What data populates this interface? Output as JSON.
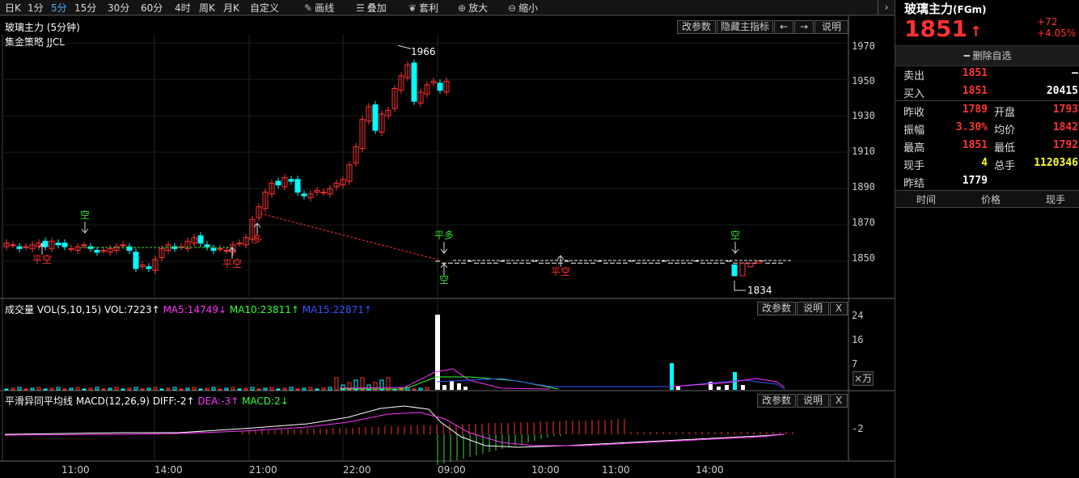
{
  "toolbar": {
    "items": [
      "日K",
      "1分",
      "5分",
      "15分",
      "30分",
      "60分",
      "4时",
      "周K",
      "月K",
      "自定义"
    ],
    "active_index": 2,
    "draw_label": "画线",
    "overlay_label": "叠加",
    "arbitrage_label": "套利",
    "zoom_in_label": "放大",
    "zoom_out_label": "缩小",
    "scroll_right": "›"
  },
  "kline": {
    "title": "玻璃主力 (5分钟)",
    "strategy": "集金策略 JJCL",
    "buttons": [
      "改参数",
      "隐藏主指标",
      "←",
      "→",
      "说明"
    ],
    "y_ticks": [
      "1970",
      "1950",
      "1930",
      "1910",
      "1890",
      "1870",
      "1850"
    ],
    "price_range": [
      1830,
      1975
    ],
    "high_marker": "1966",
    "low_marker": "1834",
    "signals": [
      {
        "text": "空",
        "color": "#33dd33",
        "pos": "above",
        "candle": 13
      },
      {
        "text": "平空",
        "color": "#ff3333",
        "pos": "below",
        "candle": 6
      },
      {
        "text": "平空",
        "color": "#ff3333",
        "pos": "below",
        "candle": 36
      },
      {
        "text": "多",
        "color": "#ff3333",
        "pos": "below",
        "candle": 39
      },
      {
        "text": "平多",
        "color": "#33dd33",
        "pos": "above",
        "candle": 69
      },
      {
        "text": "空",
        "color": "#33dd33",
        "pos": "below",
        "candle": 69
      },
      {
        "text": "平空",
        "color": "#ff3333",
        "pos": "below",
        "candle": 90
      },
      {
        "text": "空",
        "color": "#33dd33",
        "pos": "above",
        "candle": 117
      }
    ],
    "ohlc_up": "#ff3333",
    "ohlc_down": "#00ffff"
  },
  "volume": {
    "title": "成交量",
    "params": "VOL(5,10,15)",
    "vol": "VOL:7223↑",
    "ma5": "MA5:14749↓",
    "ma10": "MA10:23811↑",
    "ma15": "MA15:22871↑",
    "buttons": [
      "改参数",
      "说明",
      "X"
    ],
    "y_ticks": [
      "24",
      "16",
      "7"
    ],
    "unit": "×万"
  },
  "macd": {
    "title": "平滑异同平均线",
    "params": "MACD(12,26,9)",
    "diff": "DIFF:-2↑",
    "dea": "DEA:-3↑",
    "macd": "MACD:2↓",
    "buttons": [
      "改参数",
      "说明",
      "X"
    ],
    "y_tick": "-2"
  },
  "x_axis": [
    "11:00",
    "14:00",
    "21:00",
    "22:00",
    "09:00",
    "10:00",
    "11:00",
    "14:00"
  ],
  "quote": {
    "name": "玻璃主力",
    "code": "(FGm)",
    "price": "1851",
    "arrow": "↑",
    "change": "+72",
    "change_pct": "+4.05%",
    "remove_label": "删除自选",
    "sell_label": "卖出",
    "sell_price": "1851",
    "sell_vol": "—",
    "buy_label": "买入",
    "buy_price": "1851",
    "buy_vol": "20415",
    "prev_close_label": "昨收",
    "prev_close": "1789",
    "open_label": "开盘",
    "open": "1793",
    "amp_label": "振幅",
    "amp": "3.30%",
    "avg_label": "均价",
    "avg": "1842",
    "high_label": "最高",
    "high": "1851",
    "low_label": "最低",
    "low": "1792",
    "cur_vol_label": "现手",
    "cur_vol": "4",
    "total_vol_label": "总手",
    "total_vol": "1120346",
    "settle_label": "昨结",
    "settle": "1779",
    "table_headers": [
      "时间",
      "价格",
      "现手"
    ]
  }
}
